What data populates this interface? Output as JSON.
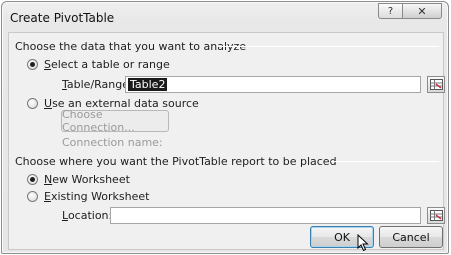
{
  "dialog": {
    "title": "Create PivotTable",
    "help_glyph": "?",
    "close_glyph": "✕"
  },
  "source_group": {
    "heading": "Choose the data that you want to analyze",
    "select_table": {
      "ul": "S",
      "rest": "elect a table or range",
      "checked": true
    },
    "table_range_label": {
      "ul": "T",
      "rest": "able/Range:"
    },
    "table_range_value": "Table2",
    "external": {
      "ul": "U",
      "rest": "se an external data source",
      "checked": false
    },
    "choose_connection_label": "Choose Connection...",
    "connection_name_label": "Connection name:"
  },
  "placement_group": {
    "heading": "Choose where you want the PivotTable report to be placed",
    "new_ws": {
      "ul": "N",
      "rest": "ew Worksheet",
      "checked": true
    },
    "existing_ws": {
      "ul": "E",
      "rest": "xisting Worksheet",
      "checked": false
    },
    "location_label": {
      "ul": "L",
      "rest": "ocation:"
    },
    "location_value": ""
  },
  "buttons": {
    "ok": "OK",
    "cancel": "Cancel"
  }
}
